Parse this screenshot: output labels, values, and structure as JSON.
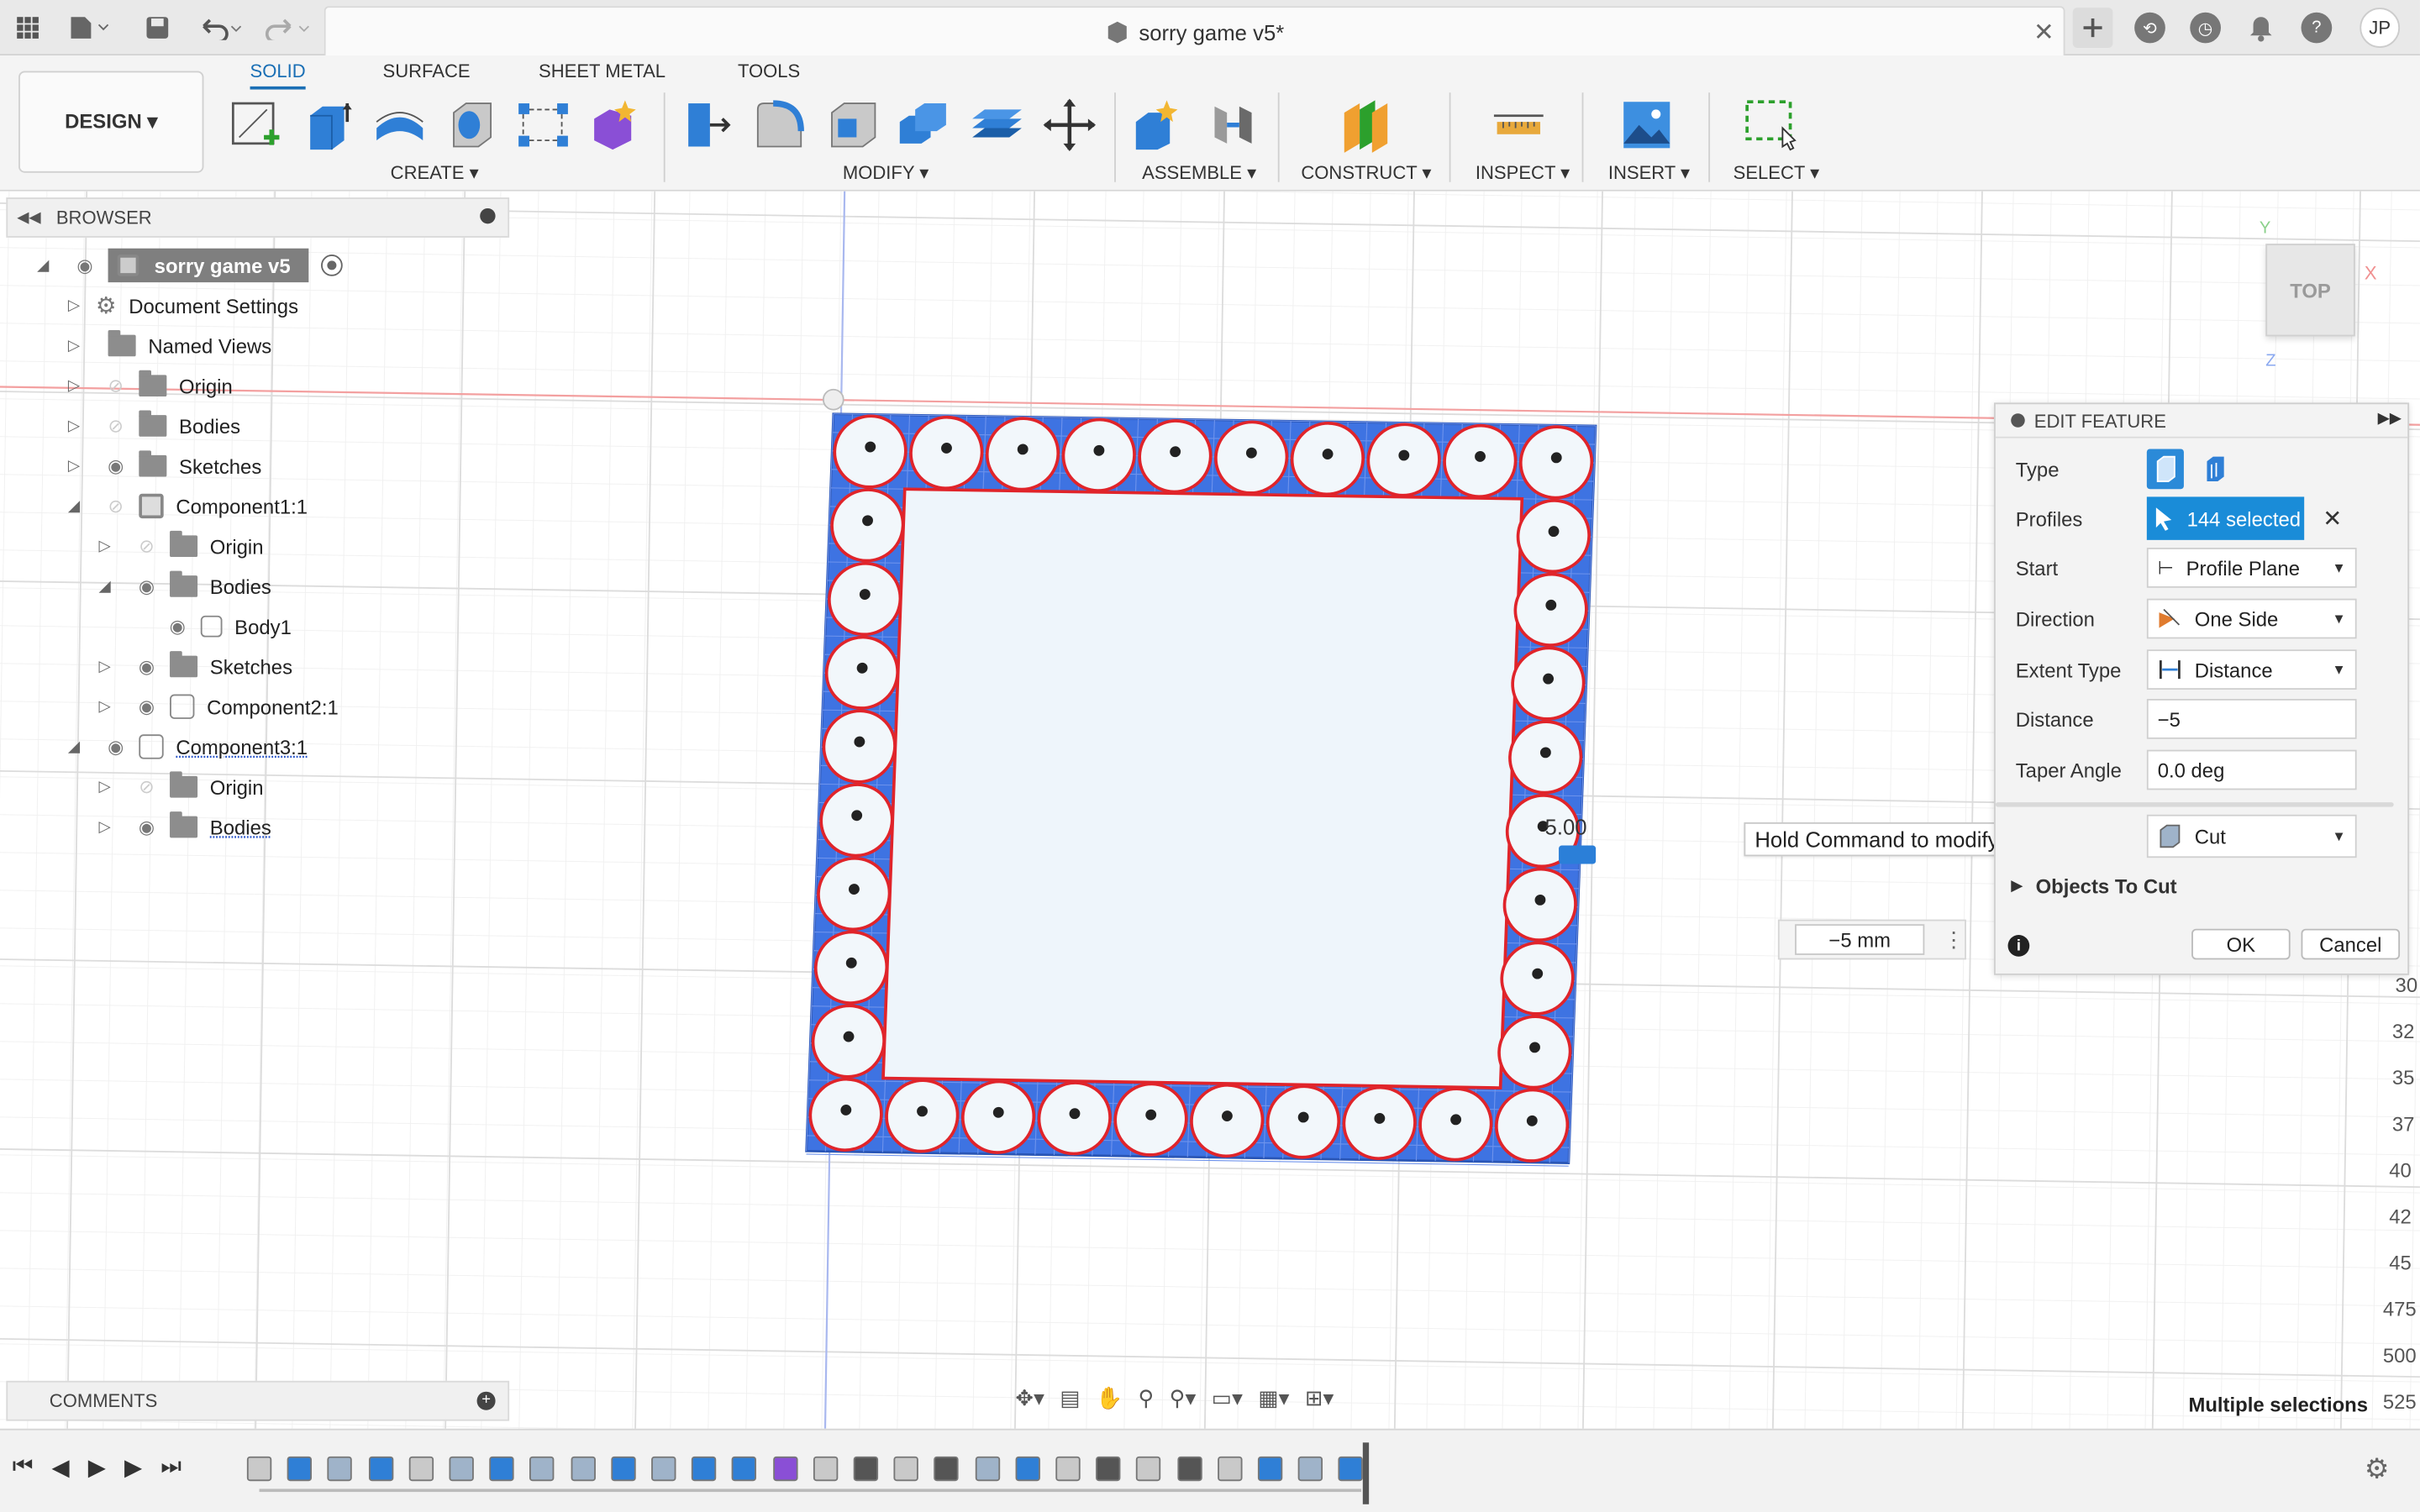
{
  "titlebar": {
    "doc_title": "sorry game v5*",
    "close_glyph": "✕",
    "avatar_initials": "JP"
  },
  "toolbar": {
    "design_label": "DESIGN ▾",
    "tabs": [
      "SOLID",
      "SURFACE",
      "SHEET METAL",
      "TOOLS"
    ],
    "active_tab": "SOLID",
    "groups": [
      "CREATE ▾",
      "MODIFY ▾",
      "ASSEMBLE ▾",
      "CONSTRUCT ▾",
      "INSPECT ▾",
      "INSERT ▾",
      "SELECT ▾"
    ]
  },
  "browser": {
    "title": "BROWSER",
    "items": [
      {
        "label": "sorry game v5"
      },
      {
        "label": "Document Settings"
      },
      {
        "label": "Named Views"
      },
      {
        "label": "Origin"
      },
      {
        "label": "Bodies"
      },
      {
        "label": "Sketches"
      },
      {
        "label": "Component1:1"
      },
      {
        "label": "Origin"
      },
      {
        "label": "Bodies"
      },
      {
        "label": "Body1"
      },
      {
        "label": "Sketches"
      },
      {
        "label": "Component2:1"
      },
      {
        "label": "Component3:1"
      },
      {
        "label": "Origin"
      },
      {
        "label": "Bodies"
      }
    ]
  },
  "comments": {
    "title": "COMMENTS"
  },
  "viewcube": {
    "label": "TOP",
    "x": "X",
    "y": "Y",
    "z": "Z"
  },
  "viewport": {
    "dimension_text": "5.00",
    "tooltip": "Hold Command to modify selection",
    "distance_input": "−5 mm",
    "status": "Multiple selections",
    "ruler_ticks": [
      "30",
      "32",
      "35",
      "37",
      "40",
      "42",
      "45",
      "475",
      "500",
      "525"
    ]
  },
  "edit_feature": {
    "title": "EDIT FEATURE",
    "type_label": "Type",
    "profiles_label": "Profiles",
    "profiles_value": "144 selected",
    "start_label": "Start",
    "start_value": "Profile Plane",
    "direction_label": "Direction",
    "direction_value": "One Side",
    "extent_label": "Extent Type",
    "extent_value": "Distance",
    "distance_label": "Distance",
    "distance_value": "−5",
    "taper_label": "Taper Angle",
    "taper_value": "0.0 deg",
    "operation_value": "Cut",
    "objects_to_cut": "Objects To Cut",
    "ok": "OK",
    "cancel": "Cancel"
  },
  "colors": {
    "accent": "#1a8cd8",
    "selection_blue": "#3d6fe0",
    "profile_red": "#e0242a"
  }
}
